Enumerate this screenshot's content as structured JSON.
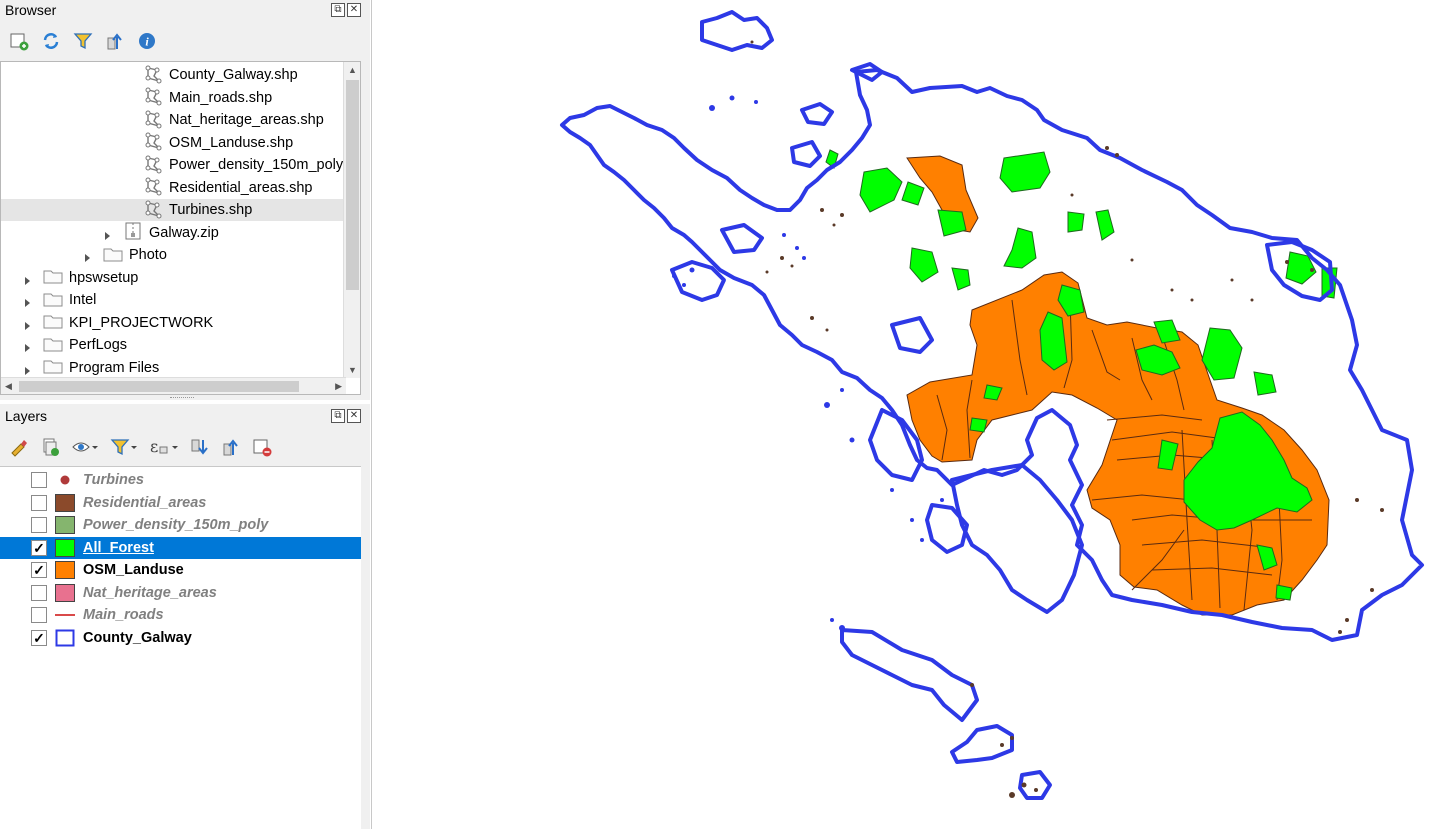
{
  "browser": {
    "title": "Browser",
    "toolbar": [
      {
        "icon": "add-layer-icon"
      },
      {
        "icon": "refresh-icon"
      },
      {
        "icon": "filter-icon"
      },
      {
        "icon": "collapse-all-icon"
      },
      {
        "icon": "info-icon"
      }
    ],
    "items": [
      {
        "label": "County_Galway.shp",
        "type": "shapefile"
      },
      {
        "label": "Main_roads.shp",
        "type": "shapefile"
      },
      {
        "label": "Nat_heritage_areas.shp",
        "type": "shapefile"
      },
      {
        "label": "OSM_Landuse.shp",
        "type": "shapefile"
      },
      {
        "label": "Power_density_150m_poly",
        "type": "shapefile"
      },
      {
        "label": "Residential_areas.shp",
        "type": "shapefile"
      },
      {
        "label": "Turbines.shp",
        "type": "shapefile",
        "selected": true
      },
      {
        "label": "Galway.zip",
        "type": "zip"
      },
      {
        "label": "Photo",
        "type": "folder"
      },
      {
        "label": "hpswsetup",
        "type": "folder"
      },
      {
        "label": "Intel",
        "type": "folder"
      },
      {
        "label": "KPI_PROJECTWORK",
        "type": "folder"
      },
      {
        "label": "PerfLogs",
        "type": "folder"
      },
      {
        "label": "Program Files",
        "type": "folder"
      }
    ]
  },
  "layers": {
    "title": "Layers",
    "toolbar": [
      {
        "icon": "style-brush-icon"
      },
      {
        "icon": "add-group-icon"
      },
      {
        "icon": "eye-icon"
      },
      {
        "icon": "filter-icon"
      },
      {
        "icon": "expression-filter-icon"
      },
      {
        "icon": "expand-all-icon"
      },
      {
        "icon": "collapse-all-icon"
      },
      {
        "icon": "remove-layer-icon"
      }
    ],
    "items": [
      {
        "label": "Turbines",
        "checked": false,
        "symbol": "point",
        "color": "#b03a3a"
      },
      {
        "label": "Residential_areas",
        "checked": false,
        "symbol": "fill",
        "color": "#8b4a2b"
      },
      {
        "label": "Power_density_150m_poly",
        "checked": false,
        "symbol": "fill",
        "color": "#85b56e"
      },
      {
        "label": "All_Forest",
        "checked": true,
        "symbol": "fill",
        "color": "#00ff00",
        "selected": true
      },
      {
        "label": "OSM_Landuse",
        "checked": true,
        "symbol": "fill",
        "color": "#ff8000"
      },
      {
        "label": "Nat_heritage_areas",
        "checked": false,
        "symbol": "fill",
        "color": "#e8718f"
      },
      {
        "label": "Main_roads",
        "checked": false,
        "symbol": "line",
        "color": "#d94a4a"
      },
      {
        "label": "County_Galway",
        "checked": true,
        "symbol": "outline",
        "color": "#2d39e6"
      }
    ]
  },
  "map": {
    "county_outline_color": "#2d39e6",
    "landuse_color": "#ff8000",
    "forest_color": "#00ff00",
    "residential_color": "#5a3a28"
  }
}
